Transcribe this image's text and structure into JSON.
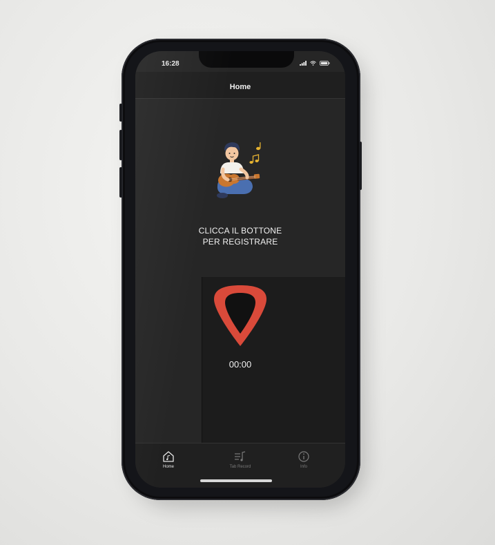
{
  "status_bar": {
    "time": "16:28",
    "icons": [
      "signal-icon",
      "wifi-icon",
      "battery-icon"
    ]
  },
  "nav": {
    "title": "Home"
  },
  "main": {
    "illustration_icon": "guitar-player-illustration",
    "instructions_line1": "CLICCA IL BOTTONE",
    "instructions_line2": "PER REGISTRARE",
    "record_button_icon": "guitar-pick-icon",
    "timer": "00:00"
  },
  "tabs": [
    {
      "label": "Home",
      "icon": "home-music-icon",
      "active": true
    },
    {
      "label": "Tab Record",
      "icon": "music-list-icon",
      "active": false
    },
    {
      "label": "Info",
      "icon": "info-icon",
      "active": false
    }
  ],
  "colors": {
    "accent": "#d94a3a",
    "background": "#262626",
    "bar": "#202020",
    "text": "#f2f2f2",
    "inactive_tab": "#7a7a7a"
  }
}
